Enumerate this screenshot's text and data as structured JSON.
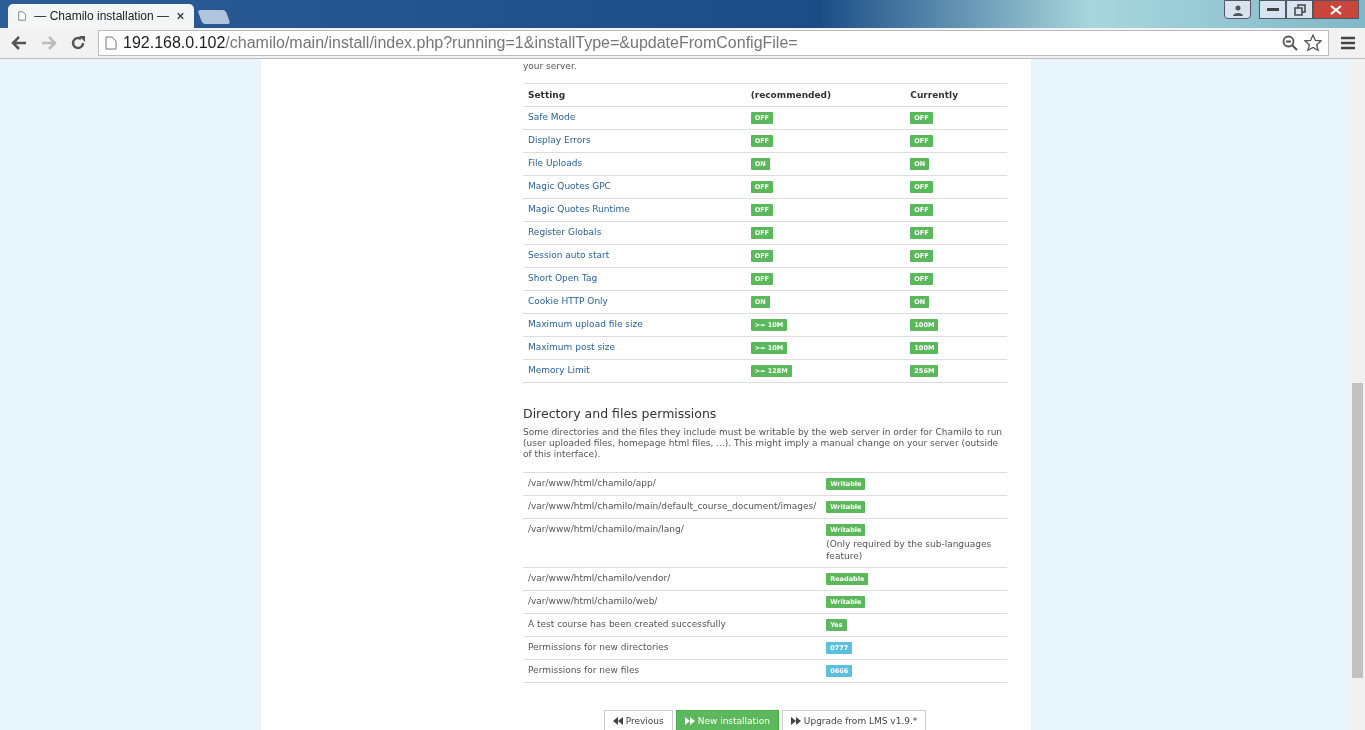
{
  "browser": {
    "tab_title": "— Chamilo installation —",
    "url_host": "192.168.0.102",
    "url_path": "/chamilo/main/install/index.php?running=1&installType=&updateFromConfigFile="
  },
  "intro_tail": "your server.",
  "settings_table": {
    "columns": [
      "Setting",
      "(recommended)",
      "Currently"
    ],
    "rows": [
      {
        "setting": "Safe Mode",
        "recommended": "OFF",
        "current": "OFF"
      },
      {
        "setting": "Display Errors",
        "recommended": "OFF",
        "current": "OFF"
      },
      {
        "setting": "File Uploads",
        "recommended": "ON",
        "current": "ON"
      },
      {
        "setting": "Magic Quotes GPC",
        "recommended": "OFF",
        "current": "OFF"
      },
      {
        "setting": "Magic Quotes Runtime",
        "recommended": "OFF",
        "current": "OFF"
      },
      {
        "setting": "Register Globals",
        "recommended": "OFF",
        "current": "OFF"
      },
      {
        "setting": "Session auto start",
        "recommended": "OFF",
        "current": "OFF"
      },
      {
        "setting": "Short Open Tag",
        "recommended": "OFF",
        "current": "OFF"
      },
      {
        "setting": "Cookie HTTP Only",
        "recommended": "ON",
        "current": "ON"
      },
      {
        "setting": "Maximum upload file size",
        "recommended": ">= 10M",
        "current": "100M"
      },
      {
        "setting": "Maximum post size",
        "recommended": ">= 10M",
        "current": "100M"
      },
      {
        "setting": "Memory Limit",
        "recommended": ">= 128M",
        "current": "256M"
      }
    ]
  },
  "permissions": {
    "heading": "Directory and files permissions",
    "description": "Some directories and the files they include must be writable by the web server in order for Chamilo to run (user uploaded files, homepage html files, ...). This might imply a manual change on your server (outside of this interface).",
    "rows": [
      {
        "item": "/var/www/html/chamilo/app/",
        "status": "Writable",
        "color": "#5cb85c"
      },
      {
        "item": "/var/www/html/chamilo/main/default_course_document/images/",
        "status": "Writable",
        "color": "#5cb85c"
      },
      {
        "item": "/var/www/html/chamilo/main/lang/",
        "status": "Writable",
        "color": "#5cb85c",
        "note": "(Only required by the sub-languages feature)"
      },
      {
        "item": "/var/www/html/chamilo/vendor/",
        "status": "Readable",
        "color": "#5cb85c"
      },
      {
        "item": "/var/www/html/chamilo/web/",
        "status": "Writable",
        "color": "#5cb85c"
      },
      {
        "item": "A test course has been created successfully",
        "status": "Yes",
        "color": "#5cb85c"
      },
      {
        "item": "Permissions for new directories",
        "status": "0777",
        "color": "#5bc0de"
      },
      {
        "item": "Permissions for new files",
        "status": "0666",
        "color": "#5bc0de"
      }
    ]
  },
  "buttons": [
    {
      "label": "Previous",
      "kind": "back",
      "primary": false
    },
    {
      "label": "New installation",
      "kind": "forward",
      "primary": true
    },
    {
      "label": "Upgrade from LMS v1.9.*",
      "kind": "forward",
      "primary": false
    }
  ]
}
